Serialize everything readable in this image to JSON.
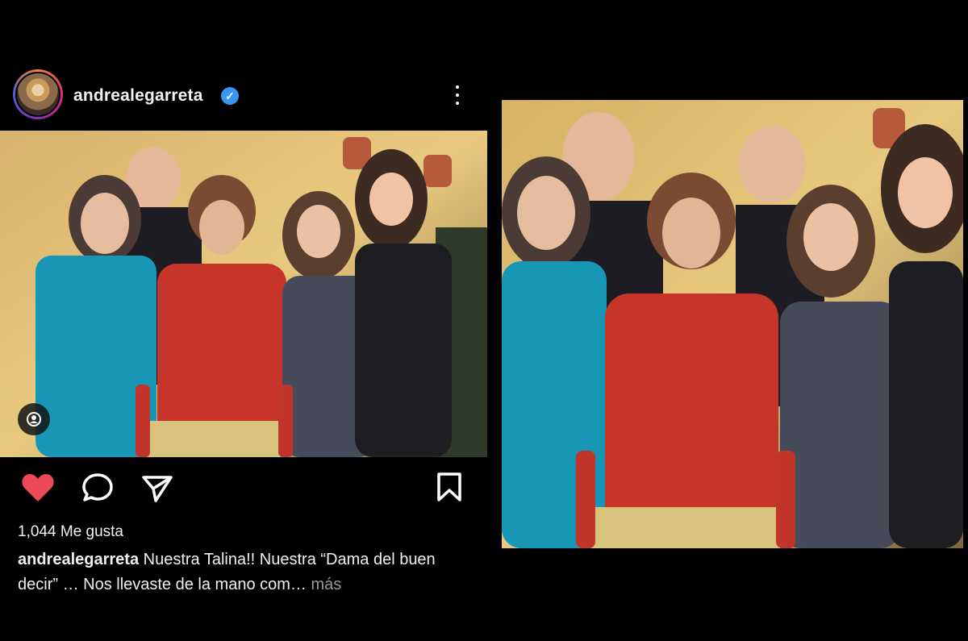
{
  "post": {
    "username": "andrealegarreta",
    "verified": true,
    "likes_text": "1,044 Me gusta",
    "caption_user": "andrealegarreta",
    "caption_text": "Nuestra Talina!! Nuestra “Dama del buen decir” … Nos llevaste de la mano com…",
    "more_label": "más",
    "liked": true
  },
  "icons": {
    "avatar": "avatar",
    "verified": "verified-badge-icon",
    "options": "more-options-icon",
    "tag": "user-tag-icon",
    "like": "heart-icon",
    "comment": "comment-icon",
    "share": "share-icon",
    "save": "bookmark-icon"
  },
  "colors": {
    "background": "#000000",
    "like": "#ed4956",
    "verified": "#3897f0",
    "muted": "#9a9a9a"
  }
}
